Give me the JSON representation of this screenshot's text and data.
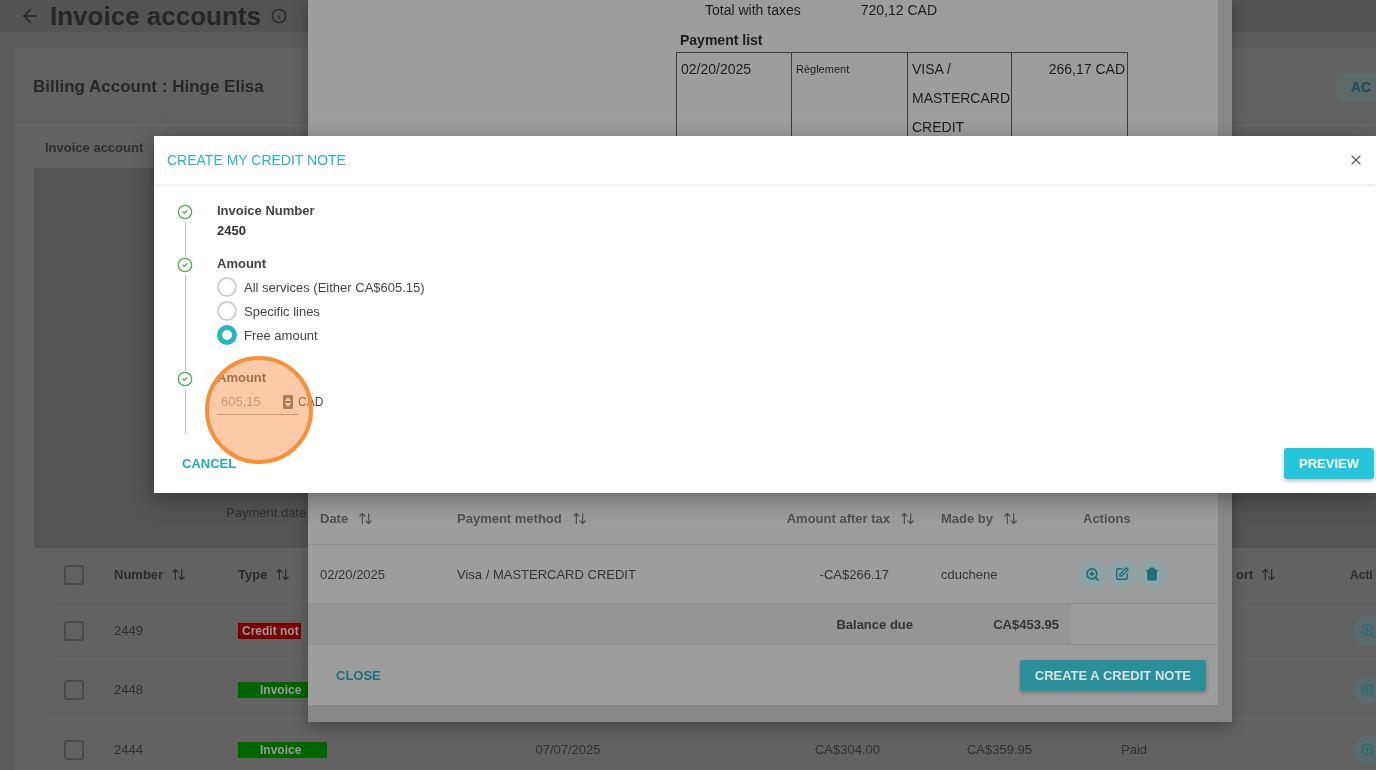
{
  "page": {
    "title": "Invoice accounts",
    "account_title": "Billing Account : Hinge Elisa",
    "account_button": "AC",
    "tab": "Invoice account",
    "filter_label": "Payment date",
    "table": {
      "select_all_checked": false,
      "columns": {
        "number": "Number",
        "type": "Type",
        "column_8": "ort",
        "column_9": "Acti"
      },
      "rows": [
        {
          "checked": false,
          "number": "2449",
          "type": {
            "label": "Credit not",
            "color": "#7a0000"
          }
        },
        {
          "checked": false,
          "number": "2448",
          "type": {
            "label": "Invoice",
            "color": "#006400"
          }
        },
        {
          "checked": false,
          "number": "2444",
          "type": {
            "label": "Invoice",
            "color": "#006400"
          },
          "date": "07/07/2025",
          "amount_1": "CA$304.00",
          "amount_2": "CA$359.95",
          "status": "Paid"
        }
      ]
    }
  },
  "invoice_dialog": {
    "totals_line": {
      "label": "Total with taxes",
      "value": "720,12 CAD"
    },
    "payment_list": {
      "title": "Payment list",
      "rows": [
        [
          "02/20/2025",
          "Règlement",
          "VISA / MASTERCARD CREDIT",
          "266,17 CAD"
        ]
      ]
    },
    "table": {
      "columns": [
        {
          "label": "Date",
          "sortable": true
        },
        {
          "label": "Payment method",
          "sortable": true
        },
        {
          "label": "Amount after tax",
          "sortable": true
        },
        {
          "label": "Made by",
          "sortable": true
        },
        {
          "label": "Actions",
          "sortable": false
        }
      ],
      "rows": [
        {
          "date": "02/20/2025",
          "method": "Visa / MASTERCARD CREDIT",
          "amount": "-CA$266.17",
          "made_by": "cduchene"
        }
      ],
      "balance": {
        "label": "Balance due",
        "value": "CA$453.95"
      }
    },
    "close": "CLOSE",
    "create": "CREATE A CREDIT NOTE"
  },
  "modal": {
    "title": "CREATE MY CREDIT NOTE",
    "steps": [
      {
        "kind": "value",
        "done": true,
        "label": "Invoice Number",
        "value": "2450"
      },
      {
        "kind": "choice",
        "done": true,
        "label": "Amount",
        "options": [
          {
            "label": "All services (Either CA$605.15)",
            "selected": false
          },
          {
            "label": "Specific lines",
            "selected": false
          },
          {
            "label": "Free amount",
            "selected": true
          }
        ]
      },
      {
        "kind": "amount",
        "done": true,
        "label": "Amount",
        "value": "605,15",
        "unit": "CAD"
      }
    ],
    "cancel": "CANCEL",
    "preview": "PREVIEW"
  }
}
